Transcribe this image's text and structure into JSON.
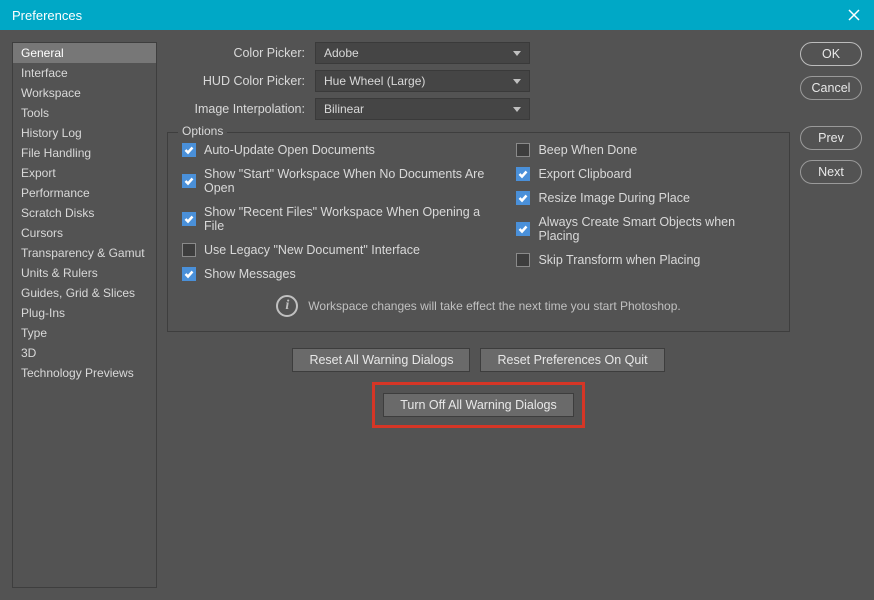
{
  "window": {
    "title": "Preferences"
  },
  "sidebar": {
    "items": [
      {
        "label": "General",
        "selected": true
      },
      {
        "label": "Interface"
      },
      {
        "label": "Workspace"
      },
      {
        "label": "Tools"
      },
      {
        "label": "History Log"
      },
      {
        "label": "File Handling"
      },
      {
        "label": "Export"
      },
      {
        "label": "Performance"
      },
      {
        "label": "Scratch Disks"
      },
      {
        "label": "Cursors"
      },
      {
        "label": "Transparency & Gamut"
      },
      {
        "label": "Units & Rulers"
      },
      {
        "label": "Guides, Grid & Slices"
      },
      {
        "label": "Plug-Ins"
      },
      {
        "label": "Type"
      },
      {
        "label": "3D"
      },
      {
        "label": "Technology Previews"
      }
    ]
  },
  "form": {
    "colorPicker": {
      "label": "Color Picker:",
      "value": "Adobe"
    },
    "hudColorPicker": {
      "label": "HUD Color Picker:",
      "value": "Hue Wheel (Large)"
    },
    "imageInterpolation": {
      "label": "Image Interpolation:",
      "value": "Bilinear"
    }
  },
  "options": {
    "legend": "Options",
    "left": [
      {
        "label": "Auto-Update Open Documents",
        "checked": true
      },
      {
        "label": "Show \"Start\" Workspace When No Documents Are Open",
        "checked": true
      },
      {
        "label": "Show \"Recent Files\" Workspace When Opening a File",
        "checked": true
      },
      {
        "label": "Use Legacy \"New Document\" Interface",
        "checked": false
      },
      {
        "label": "Show Messages",
        "checked": true
      }
    ],
    "right": [
      {
        "label": "Beep When Done",
        "checked": false
      },
      {
        "label": "Export Clipboard",
        "checked": true
      },
      {
        "label": "Resize Image During Place",
        "checked": true
      },
      {
        "label": "Always Create Smart Objects when Placing",
        "checked": true
      },
      {
        "label": "Skip Transform when Placing",
        "checked": false
      }
    ],
    "info": "Workspace changes will take effect the next time you start Photoshop."
  },
  "buttons": {
    "resetWarnings": "Reset All Warning Dialogs",
    "resetPrefs": "Reset Preferences On Quit",
    "turnOffWarnings": "Turn Off All Warning Dialogs"
  },
  "rightPanel": {
    "ok": "OK",
    "cancel": "Cancel",
    "prev": "Prev",
    "next": "Next"
  }
}
